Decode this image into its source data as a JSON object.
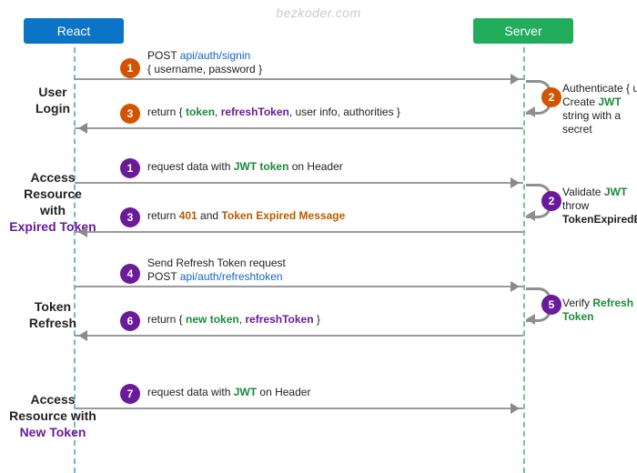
{
  "watermark": "bezkoder.com",
  "participants": {
    "left": "React",
    "right": "Server"
  },
  "sections": {
    "user_login": {
      "line1": "User",
      "line2": "Login"
    },
    "expired": {
      "line1": "Access",
      "line2": "Resource",
      "line3": "with",
      "hl": "Expired Token"
    },
    "refresh": {
      "line1": "Token",
      "line2": "Refresh"
    },
    "new_token": {
      "line1": "Access",
      "line2": "Resource with",
      "hl": "New Token"
    }
  },
  "steps": {
    "s1": {
      "n": "1",
      "pre": "POST ",
      "api": "api/auth/signin",
      "body": "{ username, password }"
    },
    "s2": {
      "n": "2",
      "l1": "Authenticate { username, password }",
      "l2a": "Create ",
      "jwt": "JWT",
      "l2b": " string with a secret"
    },
    "s3": {
      "n": "3",
      "pre": "return { ",
      "tok": "token",
      "sep1": ", ",
      "rt": "refreshToken",
      "post": ", user info, authorities }"
    },
    "s4": {
      "n": "1",
      "pre": "request data with ",
      "jwt": "JWT token",
      "post": " on Header"
    },
    "s5": {
      "n": "2",
      "l1a": "Validate ",
      "jwt": "JWT",
      "l2a": "throw ",
      "err": "TokenExpiredError"
    },
    "s6": {
      "n": "3",
      "pre": "return ",
      "code": "401",
      "mid": " and ",
      "msg": "Token Expired Message"
    },
    "s7": {
      "n": "4",
      "l1": "Send Refresh Token request",
      "l2a": "POST ",
      "api": "api/auth/refreshtoken"
    },
    "s8": {
      "n": "5",
      "pre": "Verify ",
      "rt": "Refresh Token"
    },
    "s9": {
      "n": "6",
      "pre": "return { ",
      "nt": "new token",
      "sep": ", ",
      "rt": "refreshToken",
      "post": " }"
    },
    "s10": {
      "n": "7",
      "pre": "request data with ",
      "jwt": "JWT",
      "post": " on Header"
    }
  }
}
